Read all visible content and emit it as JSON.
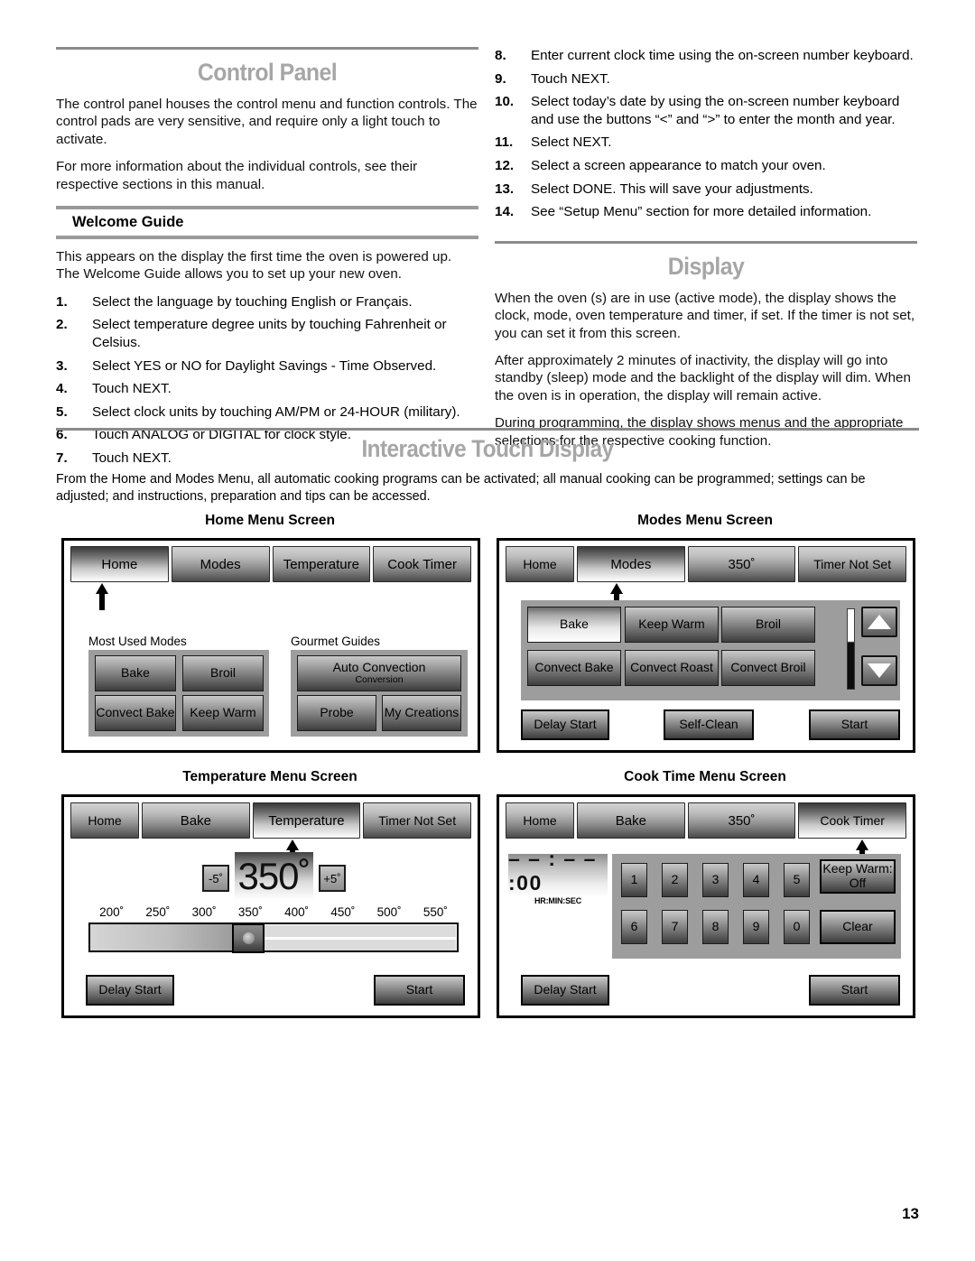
{
  "left_column": {
    "title": "Control Panel",
    "paragraphs": [
      "The control panel houses the control menu and function controls. The control pads are very sensitive, and require only a light touch to activate.",
      "For more information about the individual controls, see their respective sections in this manual."
    ],
    "subhead": "Welcome Guide",
    "welcome_intro": "This appears on the display the first time the oven is powered up. The Welcome Guide allows you to set up your new oven.",
    "steps": [
      {
        "num": "1.",
        "text": "Select the language by touching English or Français."
      },
      {
        "num": "2.",
        "text": "Select temperature degree units by touching Fahrenheit or Celsius."
      },
      {
        "num": "3.",
        "text": "Select YES or NO for Daylight Savings - Time Observed."
      },
      {
        "num": "4.",
        "text": "Touch NEXT."
      },
      {
        "num": "5.",
        "text": "Select clock units by touching AM/PM or 24-HOUR (military)."
      },
      {
        "num": "6.",
        "text": "Touch ANALOG or DIGITAL for clock style."
      },
      {
        "num": "7.",
        "text": "Touch NEXT."
      }
    ]
  },
  "right_column": {
    "steps": [
      {
        "num": "8.",
        "text": "Enter current clock time using the on-screen number keyboard."
      },
      {
        "num": "9.",
        "text": "Touch NEXT."
      },
      {
        "num": "10.",
        "text": "Select today’s date by using the on-screen number keyboard and use the buttons “<” and “>” to enter the month and year."
      },
      {
        "num": "11.",
        "text": "Select NEXT."
      },
      {
        "num": "12.",
        "text": "Select a screen appearance to match your oven."
      },
      {
        "num": "13.",
        "text": "Select DONE. This will save your adjustments."
      },
      {
        "num": "14.",
        "text": "See “Setup Menu” section for more detailed information."
      }
    ],
    "title": "Display",
    "paragraphs": [
      "When the oven (s) are in use (active mode), the display shows the clock, mode, oven temperature and timer, if set. If the timer is not set, you can set it from this screen.",
      "After approximately 2 minutes of inactivity, the display will go into standby (sleep) mode and the backlight of the display will dim. When the oven is in operation, the display will remain active.",
      "During programming, the display shows menus and the appropriate selections for the respective cooking function."
    ]
  },
  "interactive_touch_display": {
    "title": "Interactive Touch Display",
    "intro": "From the Home and Modes Menu, all automatic cooking programs can be activated; all manual cooking can be programmed; settings can be adjusted; and instructions, preparation and tips can be accessed."
  },
  "screens": {
    "home": {
      "label": "Home Menu Screen",
      "tabs": [
        {
          "label": "Home",
          "active": true
        },
        {
          "label": "Modes",
          "active": false
        },
        {
          "label": "Temperature",
          "active": false
        },
        {
          "label": "Cook Timer",
          "active": false
        }
      ],
      "most_used_label": "Most Used Modes",
      "most_used_buttons": [
        "Bake",
        "Broil",
        "Convect Bake",
        "Keep Warm"
      ],
      "gourmet_label": "Gourmet Guides",
      "gourmet_primary": {
        "label": "Auto Convection",
        "sub": "Conversion"
      },
      "gourmet_buttons": [
        "Probe",
        "My Creations"
      ]
    },
    "modes": {
      "label": "Modes Menu Screen",
      "tabs": [
        {
          "label": "Home",
          "active": false
        },
        {
          "label": "Modes",
          "active": true
        },
        {
          "label": "350˚",
          "active": false
        },
        {
          "label": "Timer Not Set",
          "active": false
        }
      ],
      "mode_buttons": [
        "Bake",
        "Keep Warm",
        "Broil",
        "Convect Bake",
        "Convect Roast",
        "Convect Broil"
      ],
      "selected_mode": "Bake",
      "scroll_up_icon": "triangle-up-icon",
      "scroll_down_icon": "triangle-down-icon",
      "footer_buttons": [
        "Delay Start",
        "Self-Clean",
        "Start"
      ]
    },
    "temperature": {
      "label": "Temperature Menu Screen",
      "tabs": [
        {
          "label": "Home",
          "active": false
        },
        {
          "label": "Bake",
          "active": false
        },
        {
          "label": "Temperature",
          "active": true
        },
        {
          "label": "Timer Not Set",
          "active": false
        }
      ],
      "decrease_label": "-5˚",
      "value": "350˚",
      "increase_label": "+5˚",
      "scale_ticks": [
        "200˚",
        "250˚",
        "300˚",
        "350˚",
        "400˚",
        "450˚",
        "500˚",
        "550˚"
      ],
      "slider_value": "350˚",
      "footer_buttons": [
        "Delay Start",
        "Start"
      ]
    },
    "cook_time": {
      "label": "Cook Time Menu Screen",
      "tabs": [
        {
          "label": "Home",
          "active": false
        },
        {
          "label": "Bake",
          "active": false
        },
        {
          "label": "350˚",
          "active": false
        },
        {
          "label": "Cook Timer",
          "active": true
        }
      ],
      "timer_value": "– –  :  – –  :00",
      "timer_unit": "HR:MIN:SEC",
      "keypad_row1": [
        "1",
        "2",
        "3",
        "4",
        "5"
      ],
      "keypad_row2": [
        "6",
        "7",
        "8",
        "9",
        "0"
      ],
      "keep_warm": {
        "label": "Keep Warm:",
        "value": "Off"
      },
      "clear_label": "Clear",
      "footer_buttons": [
        "Delay Start",
        "Start"
      ]
    }
  },
  "page_number": "13"
}
